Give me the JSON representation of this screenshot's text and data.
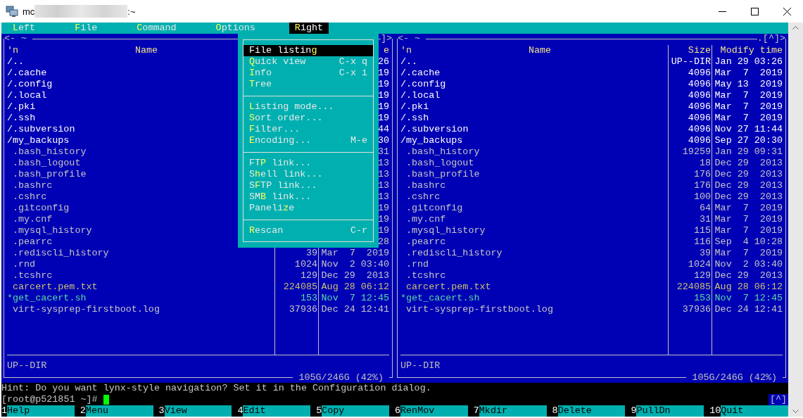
{
  "window": {
    "title_prefix": "mc",
    "title_suffix": ":~"
  },
  "menu_bar": [
    {
      "label": "**L**eft",
      "selected": false
    },
    {
      "label": "**F**ile",
      "selected": false
    },
    {
      "label": "**C**ommand",
      "selected": false
    },
    {
      "label": "**O**ptions",
      "selected": false
    },
    {
      "label": "**R**ight",
      "selected": true
    }
  ],
  "dropdown": {
    "items": [
      {
        "kind": "item",
        "label": "File listin**g**",
        "selected": true
      },
      {
        "kind": "item",
        "label": "**Q**uick view",
        "shortcut": "C-x q",
        "selected": false
      },
      {
        "kind": "item",
        "label": "**I**nfo",
        "shortcut": "C-x i",
        "selected": false
      },
      {
        "kind": "item",
        "label": "**T**ree",
        "selected": false
      },
      {
        "kind": "separator"
      },
      {
        "kind": "item",
        "label": "**L**isting mode...",
        "selected": false
      },
      {
        "kind": "item",
        "label": "**S**ort order...",
        "selected": false
      },
      {
        "kind": "item",
        "label": "**F**ilter...",
        "selected": false
      },
      {
        "kind": "item",
        "label": "**E**ncoding...",
        "shortcut": "M-e",
        "selected": false
      },
      {
        "kind": "separator"
      },
      {
        "kind": "item",
        "label": "FT**P** link...",
        "selected": false
      },
      {
        "kind": "item",
        "label": "S**h**ell link...",
        "selected": false
      },
      {
        "kind": "item",
        "label": "S**F**TP link...",
        "selected": false
      },
      {
        "kind": "item",
        "label": "SM**B** link...",
        "selected": false
      },
      {
        "kind": "item",
        "label": "Paneli**z**e",
        "selected": false
      },
      {
        "kind": "separator"
      },
      {
        "kind": "item",
        "label": "**R**escan",
        "shortcut": "C-r",
        "selected": false
      }
    ]
  },
  "panels": [
    {
      "title": "<- ~",
      "top_right": "]>",
      "header": {
        "sort": "'n",
        "name": "Name",
        "time": "e"
      },
      "rows": [
        {
          "name": "/..",
          "kind": "dir",
          "time": "26"
        },
        {
          "name": "/.cache",
          "kind": "dir",
          "time": "19"
        },
        {
          "name": "/.config",
          "kind": "dir",
          "time": "19"
        },
        {
          "name": "/.local",
          "kind": "dir",
          "time": "19"
        },
        {
          "name": "/.pki",
          "kind": "dir",
          "time": "19"
        },
        {
          "name": "/.ssh",
          "kind": "dir",
          "time": "19"
        },
        {
          "name": "/.subversion",
          "kind": "dir",
          "time": "44"
        },
        {
          "name": "/my_backups",
          "kind": "dir",
          "time": "30"
        },
        {
          "name": ".bash_history",
          "kind": "file",
          "time": "31"
        },
        {
          "name": ".bash_logout",
          "kind": "file",
          "time": "13"
        },
        {
          "name": ".bash_profile",
          "kind": "file",
          "time": "13"
        },
        {
          "name": ".bashrc",
          "kind": "file",
          "time": "13"
        },
        {
          "name": ".cshrc",
          "kind": "file",
          "time": "13"
        },
        {
          "name": ".gitconfig",
          "kind": "file",
          "time": "19"
        },
        {
          "name": ".my.cnf",
          "kind": "file",
          "time": "19"
        },
        {
          "name": ".mysql_history",
          "kind": "file",
          "time": "19"
        },
        {
          "name": ".pearrc",
          "kind": "file",
          "time": "28"
        },
        {
          "name": ".rediscli_history",
          "kind": "file",
          "size": "39",
          "time": "Mar  7  2019"
        },
        {
          "name": ".rnd",
          "kind": "file",
          "size": "1024",
          "time": "Nov  2 03:40"
        },
        {
          "name": ".tcshrc",
          "kind": "file",
          "size": "129",
          "time": "Dec 29  2013"
        },
        {
          "name": "carcert.pem.txt",
          "kind": "document",
          "size": "224085",
          "time": "Aug 28 06:12"
        },
        {
          "name": "*get_cacert.sh",
          "kind": "executable",
          "size": "153",
          "time": "Nov  7 12:45"
        },
        {
          "name": "virt-sysprep-firstboot.log",
          "kind": "file",
          "size": "37936",
          "time": "Dec 24 12:41"
        }
      ],
      "status": "UP--DIR",
      "disk": "105G/246G (42%)"
    },
    {
      "title": "<- ~",
      "top_right": ".[^]>",
      "header": {
        "sort": "'n",
        "name": "Name",
        "size": "Size",
        "time": "Modify time"
      },
      "rows": [
        {
          "name": "/..",
          "kind": "dir",
          "size": "UP--DIR",
          "time": "Jan 29 03:26"
        },
        {
          "name": "/.cache",
          "kind": "dir",
          "size": "4096",
          "time": "Mar  7  2019"
        },
        {
          "name": "/.config",
          "kind": "dir",
          "size": "4096",
          "time": "May 13  2019"
        },
        {
          "name": "/.local",
          "kind": "dir",
          "size": "4096",
          "time": "Mar  7  2019"
        },
        {
          "name": "/.pki",
          "kind": "dir",
          "size": "4096",
          "time": "Mar  7  2019"
        },
        {
          "name": "/.ssh",
          "kind": "dir",
          "size": "4096",
          "time": "Mar  7  2019"
        },
        {
          "name": "/.subversion",
          "kind": "dir",
          "size": "4096",
          "time": "Nov 27 11:44"
        },
        {
          "name": "/my_backups",
          "kind": "dir",
          "size": "4096",
          "time": "Sep 27 20:30"
        },
        {
          "name": ".bash_history",
          "kind": "file",
          "size": "19259",
          "time": "Jan 29 09:31"
        },
        {
          "name": ".bash_logout",
          "kind": "file",
          "size": "18",
          "time": "Dec 29  2013"
        },
        {
          "name": ".bash_profile",
          "kind": "file",
          "size": "176",
          "time": "Dec 29  2013"
        },
        {
          "name": ".bashrc",
          "kind": "file",
          "size": "176",
          "time": "Dec 29  2013"
        },
        {
          "name": ".cshrc",
          "kind": "file",
          "size": "100",
          "time": "Dec 29  2013"
        },
        {
          "name": ".gitconfig",
          "kind": "file",
          "size": "64",
          "time": "Mar  7  2019"
        },
        {
          "name": ".my.cnf",
          "kind": "file",
          "size": "31",
          "time": "Mar  7  2019"
        },
        {
          "name": ".mysql_history",
          "kind": "file",
          "size": "115",
          "time": "Mar  7  2019"
        },
        {
          "name": ".pearrc",
          "kind": "file",
          "size": "116",
          "time": "Sep  4 10:28"
        },
        {
          "name": ".rediscli_history",
          "kind": "file",
          "size": "39",
          "time": "Mar  7  2019"
        },
        {
          "name": ".rnd",
          "kind": "file",
          "size": "1024",
          "time": "Nov  2 03:40"
        },
        {
          "name": ".tcshrc",
          "kind": "file",
          "size": "129",
          "time": "Dec 29  2013"
        },
        {
          "name": "carcert.pem.txt",
          "kind": "document",
          "size": "224085",
          "time": "Aug 28 06:12"
        },
        {
          "name": "*get_cacert.sh",
          "kind": "executable",
          "size": "153",
          "time": "Nov  7 12:45"
        },
        {
          "name": "virt-sysprep-firstboot.log",
          "kind": "file",
          "size": "37936",
          "time": "Dec 24 12:41"
        }
      ],
      "status": "UP--DIR",
      "disk": "105G/246G (42%)"
    }
  ],
  "hint": "Hint: Do you want lynx-style navigation? Set it in the Configuration dialog.",
  "command_line": {
    "prompt": "[root@p521851 ~]#",
    "scroll_marker": "[^]"
  },
  "function_keys": [
    {
      "key": "1",
      "label": "Help"
    },
    {
      "key": "2",
      "label": "Menu"
    },
    {
      "key": "3",
      "label": "View"
    },
    {
      "key": "4",
      "label": "Edit"
    },
    {
      "key": "5",
      "label": "Copy"
    },
    {
      "key": "6",
      "label": "RenMov"
    },
    {
      "key": "7",
      "label": "Mkdir"
    },
    {
      "key": "8",
      "label": "Delete"
    },
    {
      "key": "9",
      "label": "PullDn"
    },
    {
      "key": "10",
      "label": "Quit"
    }
  ]
}
